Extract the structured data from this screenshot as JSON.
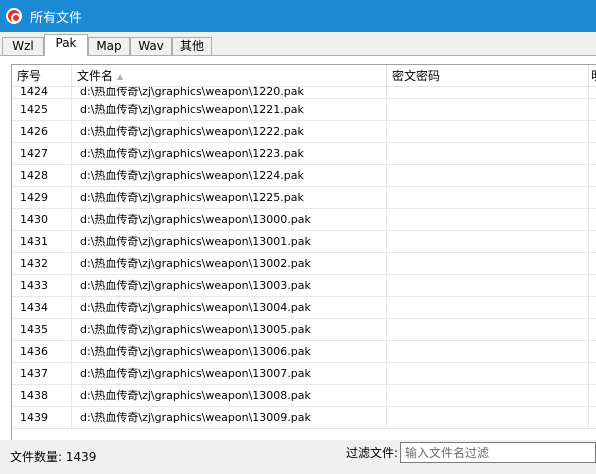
{
  "window": {
    "title": "所有文件",
    "accent": "#1a8ad4"
  },
  "tabs": [
    {
      "label": "Wzl"
    },
    {
      "label": "Pak"
    },
    {
      "label": "Map"
    },
    {
      "label": "Wav"
    },
    {
      "label": "其他"
    }
  ],
  "active_tab": "Pak",
  "table": {
    "columns": [
      "序号",
      "文件名",
      "密文密码",
      "明"
    ],
    "sort_column": "文件名",
    "rows": [
      {
        "idx": "1424",
        "name": "d:\\热血传奇\\zj\\graphics\\weapon\\1220.pak",
        "pw": "",
        "extra": ""
      },
      {
        "idx": "1425",
        "name": "d:\\热血传奇\\zj\\graphics\\weapon\\1221.pak",
        "pw": "",
        "extra": ""
      },
      {
        "idx": "1426",
        "name": "d:\\热血传奇\\zj\\graphics\\weapon\\1222.pak",
        "pw": "",
        "extra": ""
      },
      {
        "idx": "1427",
        "name": "d:\\热血传奇\\zj\\graphics\\weapon\\1223.pak",
        "pw": "",
        "extra": ""
      },
      {
        "idx": "1428",
        "name": "d:\\热血传奇\\zj\\graphics\\weapon\\1224.pak",
        "pw": "",
        "extra": ""
      },
      {
        "idx": "1429",
        "name": "d:\\热血传奇\\zj\\graphics\\weapon\\1225.pak",
        "pw": "",
        "extra": ""
      },
      {
        "idx": "1430",
        "name": "d:\\热血传奇\\zj\\graphics\\weapon\\13000.pak",
        "pw": "",
        "extra": ""
      },
      {
        "idx": "1431",
        "name": "d:\\热血传奇\\zj\\graphics\\weapon\\13001.pak",
        "pw": "",
        "extra": ""
      },
      {
        "idx": "1432",
        "name": "d:\\热血传奇\\zj\\graphics\\weapon\\13002.pak",
        "pw": "",
        "extra": ""
      },
      {
        "idx": "1433",
        "name": "d:\\热血传奇\\zj\\graphics\\weapon\\13003.pak",
        "pw": "",
        "extra": ""
      },
      {
        "idx": "1434",
        "name": "d:\\热血传奇\\zj\\graphics\\weapon\\13004.pak",
        "pw": "",
        "extra": ""
      },
      {
        "idx": "1435",
        "name": "d:\\热血传奇\\zj\\graphics\\weapon\\13005.pak",
        "pw": "",
        "extra": ""
      },
      {
        "idx": "1436",
        "name": "d:\\热血传奇\\zj\\graphics\\weapon\\13006.pak",
        "pw": "",
        "extra": ""
      },
      {
        "idx": "1437",
        "name": "d:\\热血传奇\\zj\\graphics\\weapon\\13007.pak",
        "pw": "",
        "extra": ""
      },
      {
        "idx": "1438",
        "name": "d:\\热血传奇\\zj\\graphics\\weapon\\13008.pak",
        "pw": "",
        "extra": ""
      },
      {
        "idx": "1439",
        "name": "d:\\热血传奇\\zj\\graphics\\weapon\\13009.pak",
        "pw": "",
        "extra": ""
      }
    ]
  },
  "footer": {
    "count_label": "文件数量: 1439",
    "filter_label": "过滤文件:",
    "filter_placeholder": "输入文件名过滤",
    "filter_value": ""
  }
}
